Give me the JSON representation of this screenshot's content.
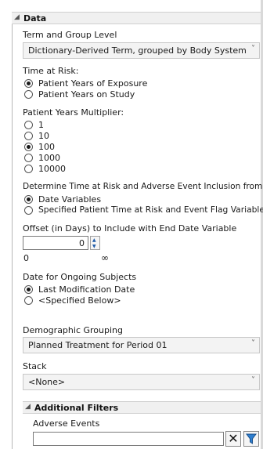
{
  "data_section": {
    "title": "Data",
    "term_group": {
      "label": "Term and Group Level",
      "value": "Dictionary-Derived Term, grouped by Body System c"
    },
    "time_at_risk": {
      "label": "Time at Risk:",
      "options": [
        "Patient Years of Exposure",
        "Patient Years on Study"
      ],
      "selected": 0
    },
    "multiplier": {
      "label": "Patient Years Multiplier:",
      "options": [
        "1",
        "10",
        "100",
        "1000",
        "10000"
      ],
      "selected": 2
    },
    "inclusion": {
      "label": "Determine Time at Risk and Adverse Event Inclusion from:",
      "options": [
        "Date Variables",
        "Specified Patient Time at Risk and Event Flag Variables"
      ],
      "selected": 0
    },
    "offset": {
      "label": "Offset (in Days) to Include with End Date Variable",
      "value": "0",
      "range_min": "0",
      "range_max": "∞"
    },
    "ongoing": {
      "label": "Date for Ongoing Subjects",
      "options": [
        "Last Modification Date",
        "<Specified Below>"
      ],
      "selected": 0
    },
    "demographic": {
      "label": "Demographic Grouping",
      "value": "Planned Treatment for Period 01"
    },
    "stack": {
      "label": "Stack",
      "value": "<None>"
    }
  },
  "additional_filters": {
    "title": "Additional Filters",
    "adverse_events_label": "Adverse Events",
    "adverse_events_value": ""
  },
  "icons": {
    "collapse": "disclosure-triangle-icon",
    "dropdown": "chevron-down-icon",
    "clear": "clear-x-icon",
    "filter": "funnel-filter-icon"
  },
  "colors": {
    "header_bg": "#f0f0f0",
    "funnel_blue": "#2e7fd0"
  }
}
